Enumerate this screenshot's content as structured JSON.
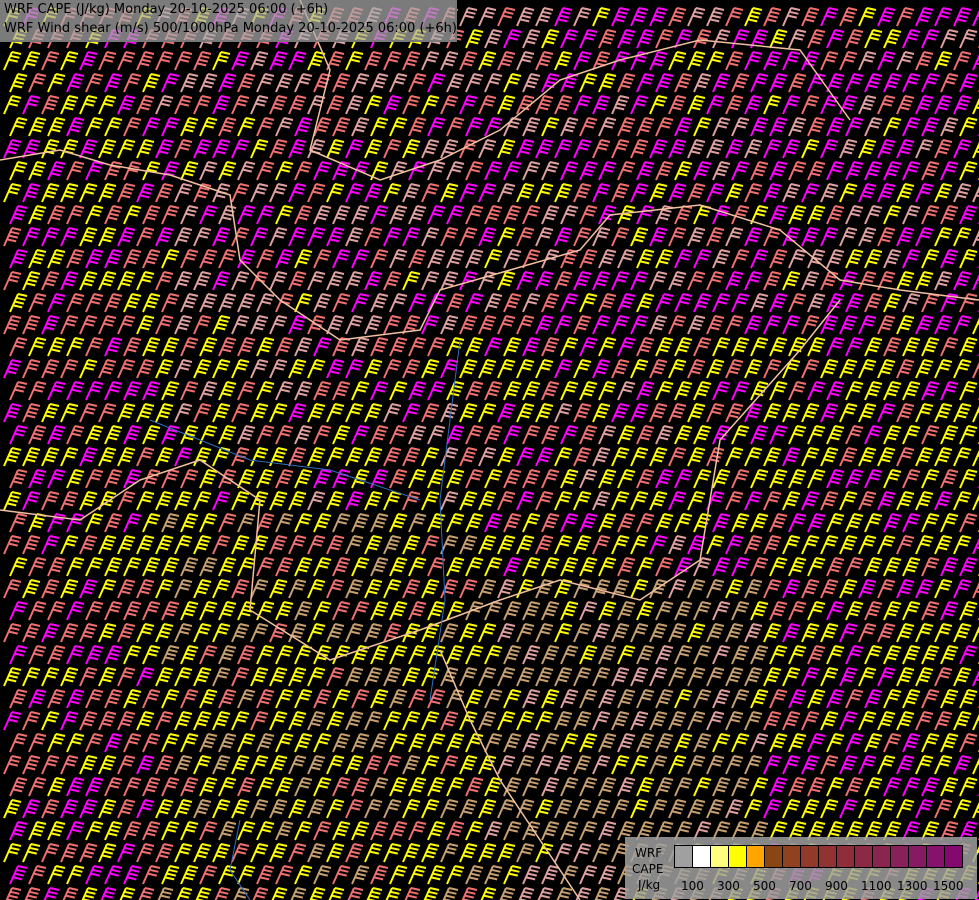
{
  "title": {
    "line1": "WRF CAPE (J/kg) Monday 20-10-2025 06:00 (+6h)",
    "line2": "WRF Wind shear (m/s) 500/1000hPa Monday 20-10-2025 06:00 (+6h)"
  },
  "legend": {
    "label1": "WRF",
    "label2": "CAPE",
    "label3": "J/kg",
    "colors": [
      "#a0a0a0",
      "#ffffff",
      "#ffff80",
      "#ffff00",
      "#ffa500",
      "#8b4513",
      "#8f4120",
      "#913a2a",
      "#923333",
      "#8f2d3a",
      "#8c2a45",
      "#8a2550",
      "#88205a",
      "#861a63",
      "#85126b",
      "#850870"
    ],
    "ticks": [
      "100",
      "300",
      "500",
      "700",
      "900",
      "1100",
      "1300",
      "1500"
    ]
  },
  "barb_colors": {
    "yellow": "#ffff00",
    "salmon": "#f07070",
    "magenta": "#ff00ff",
    "pink": "#e0a0a0",
    "tan": "#c8a070"
  },
  "border_color": "#f0c0a0",
  "river_color": "#3070c0"
}
